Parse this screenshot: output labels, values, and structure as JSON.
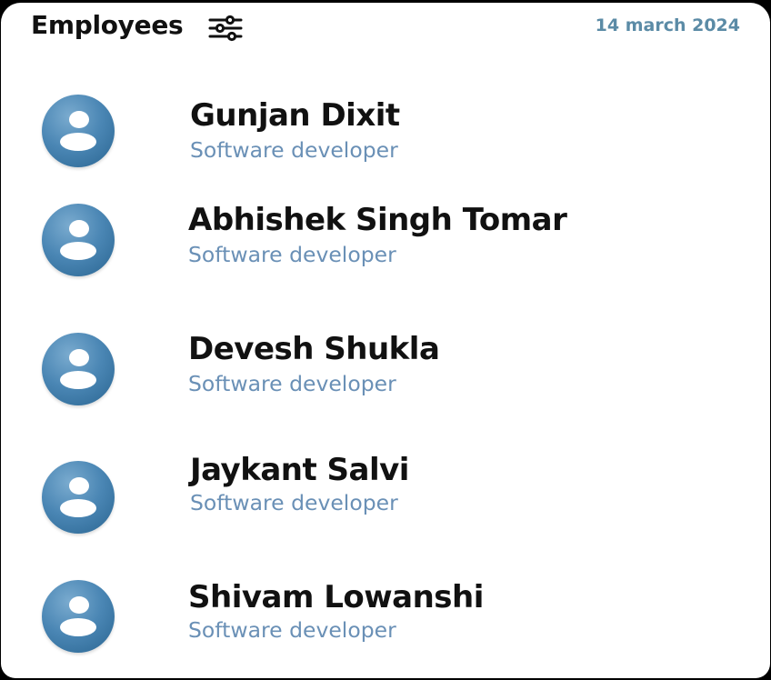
{
  "header": {
    "title": "Employees",
    "date": "14 march 2024",
    "filter_icon": "sliders-icon"
  },
  "employees": [
    {
      "name": "Gunjan Dixit",
      "role": "Software developer",
      "avatar_icon": "user-icon"
    },
    {
      "name": "Abhishek Singh Tomar",
      "role": "Software developer",
      "avatar_icon": "user-icon"
    },
    {
      "name": "Devesh Shukla",
      "role": "Software developer",
      "avatar_icon": "user-icon"
    },
    {
      "name": "Jaykant Salvi",
      "role": "Software developer",
      "avatar_icon": "user-icon"
    },
    {
      "name": "Shivam Lowanshi",
      "role": "Software developer",
      "avatar_icon": "user-icon"
    }
  ],
  "colors": {
    "accent": "#5b8ba6",
    "avatar": "#4a86b4",
    "role_text": "#6a90b6"
  }
}
